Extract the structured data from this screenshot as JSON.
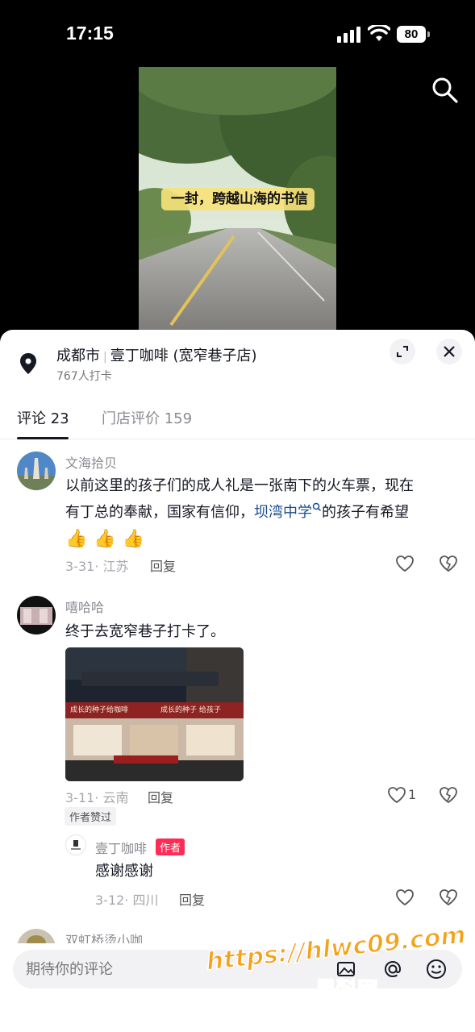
{
  "status": {
    "time": "17:15",
    "battery": "80"
  },
  "video": {
    "overlay_text": "一封，跨越山海的书信"
  },
  "place": {
    "city": "成都市",
    "name": "壹丁咖啡 (宽窄巷子店)",
    "checkins": "767人打卡"
  },
  "tabs": {
    "comments": "评论 23",
    "reviews": "门店评价 159"
  },
  "comments": [
    {
      "user": "文海拾贝",
      "text_line1": "以前这里的孩子们的成人礼是一张南下的火车票，现在",
      "text_line2_pre": "有丁总的奉献，国家有信仰，",
      "text_line2_link": "坝湾中学",
      "text_line2_post": "的孩子有希望",
      "emojis": "👍👍👍",
      "date_loc": "3-31· 江苏",
      "reply": "回复"
    },
    {
      "user": "嘻哈哈",
      "text": "终于去宽窄巷子打卡了。",
      "image_signs": {
        "sign_left": "成长的种子给咖啡",
        "sign_right": "成长的种子 给孩子"
      },
      "date_loc": "3-11· 云南",
      "reply": "回复",
      "likes": "1",
      "author_liked": "作者赞过",
      "sub_reply": {
        "user": "壹丁咖啡",
        "author_tag": "作者",
        "text": "感谢感谢",
        "date_loc": "3-12· 四川",
        "reply": "回复"
      }
    },
    {
      "user": "双虹桥烫小咖"
    }
  ],
  "input": {
    "placeholder": "期待你的评论"
  },
  "watermark": {
    "url": "https://hlwc09.com",
    "name": "黑料网"
  }
}
